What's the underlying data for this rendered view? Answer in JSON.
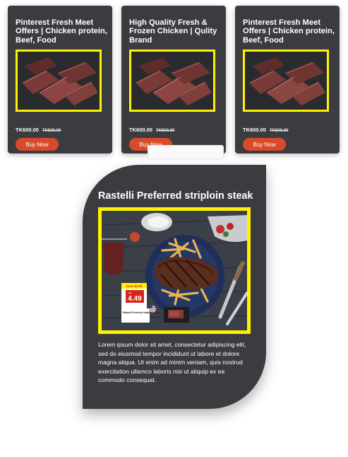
{
  "products": [
    {
      "title": "Pinterest Fresh Meet Offers | Chicken protein, Beef, Food",
      "price": "TK600.00",
      "old_price": "TK500.00",
      "button": "Buy Now"
    },
    {
      "title": "High Quality Fresh & Frozen Chicken | Qulity Brand",
      "price": "TK600.00",
      "old_price": "TK500.00",
      "button": "Buy Now"
    },
    {
      "title": "Pinterest Fresh Meet Offers | Chicken protein, Beef, Food",
      "price": "TK600.00",
      "old_price": "TK500.00",
      "button": "Buy Now"
    }
  ],
  "feature": {
    "title": "Rastelli Preferred striploin steak",
    "description": "Lorem ipsum dolor sit amet, consectetur adipiscing elit, sed do eiusmod tempor incididunt ut labore et dolore magna aliqua. Ut enim ad minim veniam, quis nostrud exercitation ullamco laboris nisi ut aliquip ex ea commodo consequat.",
    "image": {
      "save_text": "save $2.50",
      "ea_text": "ea",
      "price_text": "4.49",
      "product_text": "Rastelli Preferred striploin steak"
    }
  },
  "colors": {
    "card": "#3b3c3f",
    "button": "#d94a2b",
    "frame": "#fff200"
  }
}
